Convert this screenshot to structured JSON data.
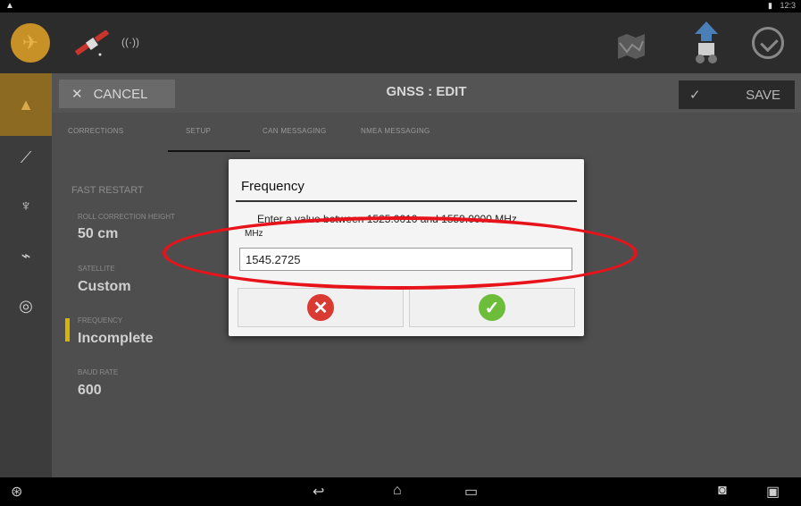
{
  "dialog": {
    "title": "Frequency",
    "message": "Enter a value between 1525.0010 and 1559.0000 MHz",
    "unit_label": "MHz",
    "value": "1545.2725",
    "cancel_glyph": "✕",
    "ok_glyph": "✓"
  },
  "header": {
    "title": "GNSS : EDIT",
    "cancel_label": "CANCEL",
    "save_label": "SAVE",
    "cancel_glyph": "✕",
    "save_glyph": "✓"
  },
  "tabs": [
    "CORRECTIONS",
    "SETUP",
    "CAN MESSAGING",
    "NMEA MESSAGING"
  ],
  "settings": {
    "fast_restart": "FAST RESTART",
    "items": [
      {
        "label": "ROLL CORRECTION HEIGHT",
        "value": "50 cm"
      },
      {
        "label": "SATELLITE",
        "value": "Custom"
      },
      {
        "label": "FREQUENCY",
        "value": "Incomplete"
      },
      {
        "label": "BAUD RATE",
        "value": "600"
      }
    ]
  },
  "statusbar": {
    "time": "12:3"
  },
  "icons": {
    "app_logo": "logo-icon",
    "satellite": "satellite-icon",
    "signal": "signal-icon",
    "map": "map-icon",
    "tractor": "tractor-icon",
    "steering": "steering-wheel-icon",
    "home": "home-icon",
    "run": "run-icon",
    "vehicle": "vehicle-icon",
    "pulse": "pulse-icon",
    "gauge": "gauge-icon"
  },
  "colors": {
    "accent": "#c89128",
    "cancel_red": "#d93a32",
    "ok_green": "#6cbd3a",
    "annotation_red": "#e8131a",
    "warning": "#d8b400"
  }
}
